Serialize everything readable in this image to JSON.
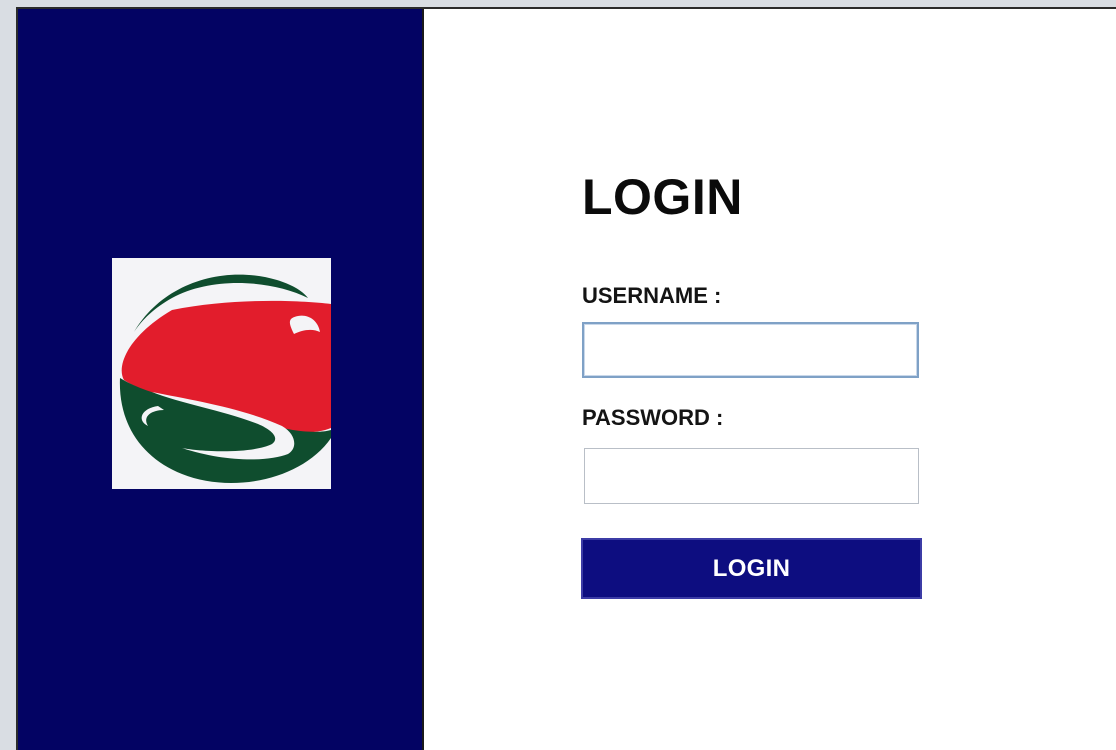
{
  "brand": {
    "logo_icon": "s-globe-logo",
    "colors": {
      "panel": "#030363",
      "logo_green": "#0f4d2e",
      "logo_red": "#e21d2c",
      "button": "#0d0d80"
    }
  },
  "login_form": {
    "title": "LOGIN",
    "username_label": "USERNAME :",
    "username_value": "",
    "password_label": "PASSWORD :",
    "password_value": "",
    "submit_label": "LOGIN"
  }
}
